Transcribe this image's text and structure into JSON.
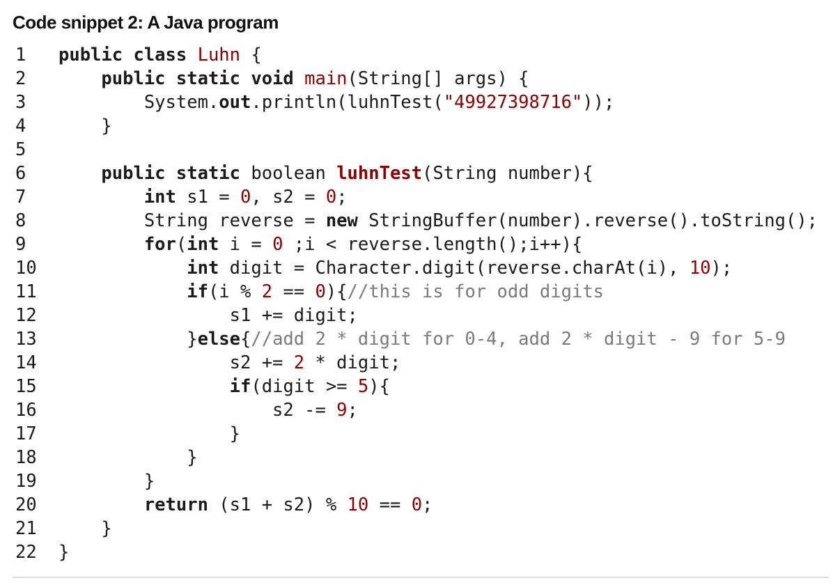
{
  "snippet": {
    "title": "Code snippet 2: A Java program",
    "lines": [
      {
        "number": "1",
        "tokens": [
          {
            "t": "public class ",
            "k": "keyword"
          },
          {
            "t": "Luhn",
            "k": "class"
          },
          {
            "t": " {",
            "k": "plain"
          }
        ]
      },
      {
        "number": "2",
        "tokens": [
          {
            "t": "    ",
            "k": "plain"
          },
          {
            "t": "public static void ",
            "k": "keyword"
          },
          {
            "t": "main",
            "k": "method"
          },
          {
            "t": "(String[] args) {",
            "k": "plain"
          }
        ]
      },
      {
        "number": "3",
        "tokens": [
          {
            "t": "        System.",
            "k": "plain"
          },
          {
            "t": "out",
            "k": "field"
          },
          {
            "t": ".println(luhnTest(",
            "k": "plain"
          },
          {
            "t": "\"49927398716\"",
            "k": "string"
          },
          {
            "t": "));",
            "k": "plain"
          }
        ]
      },
      {
        "number": "4",
        "tokens": [
          {
            "t": "    }",
            "k": "plain"
          }
        ]
      },
      {
        "number": "5",
        "tokens": []
      },
      {
        "number": "6",
        "tokens": [
          {
            "t": "    ",
            "k": "plain"
          },
          {
            "t": "public static ",
            "k": "keyword"
          },
          {
            "t": "boolean ",
            "k": "plain"
          },
          {
            "t": "luhnTest",
            "k": "method-bold"
          },
          {
            "t": "(String number){",
            "k": "plain"
          }
        ]
      },
      {
        "number": "7",
        "tokens": [
          {
            "t": "        ",
            "k": "plain"
          },
          {
            "t": "int",
            "k": "keyword"
          },
          {
            "t": " s1 = ",
            "k": "plain"
          },
          {
            "t": "0",
            "k": "number"
          },
          {
            "t": ", s2 = ",
            "k": "plain"
          },
          {
            "t": "0",
            "k": "number"
          },
          {
            "t": ";",
            "k": "plain"
          }
        ]
      },
      {
        "number": "8",
        "tokens": [
          {
            "t": "        String reverse = ",
            "k": "plain"
          },
          {
            "t": "new",
            "k": "keyword"
          },
          {
            "t": " StringBuffer(number).reverse().toString();",
            "k": "plain"
          }
        ]
      },
      {
        "number": "9",
        "tokens": [
          {
            "t": "        ",
            "k": "plain"
          },
          {
            "t": "for",
            "k": "keyword"
          },
          {
            "t": "(",
            "k": "plain"
          },
          {
            "t": "int",
            "k": "keyword"
          },
          {
            "t": " i = ",
            "k": "plain"
          },
          {
            "t": "0",
            "k": "number"
          },
          {
            "t": " ;i < reverse.length();i++){",
            "k": "plain"
          }
        ]
      },
      {
        "number": "10",
        "tokens": [
          {
            "t": "            ",
            "k": "plain"
          },
          {
            "t": "int",
            "k": "keyword"
          },
          {
            "t": " digit = Character.digit(reverse.charAt(i), ",
            "k": "plain"
          },
          {
            "t": "10",
            "k": "number"
          },
          {
            "t": ");",
            "k": "plain"
          }
        ]
      },
      {
        "number": "11",
        "tokens": [
          {
            "t": "            ",
            "k": "plain"
          },
          {
            "t": "if",
            "k": "keyword"
          },
          {
            "t": "(i % ",
            "k": "plain"
          },
          {
            "t": "2",
            "k": "number"
          },
          {
            "t": " == ",
            "k": "plain"
          },
          {
            "t": "0",
            "k": "number"
          },
          {
            "t": "){",
            "k": "plain"
          },
          {
            "t": "//this is for odd digits",
            "k": "comment"
          }
        ]
      },
      {
        "number": "12",
        "tokens": [
          {
            "t": "                s1 += digit;",
            "k": "plain"
          }
        ]
      },
      {
        "number": "13",
        "tokens": [
          {
            "t": "            }",
            "k": "plain"
          },
          {
            "t": "else",
            "k": "keyword"
          },
          {
            "t": "{",
            "k": "plain"
          },
          {
            "t": "//add 2 * digit for 0-4, add 2 * digit - 9 for 5-9",
            "k": "comment"
          }
        ]
      },
      {
        "number": "14",
        "tokens": [
          {
            "t": "                s2 += ",
            "k": "plain"
          },
          {
            "t": "2",
            "k": "number"
          },
          {
            "t": " * digit;",
            "k": "plain"
          }
        ]
      },
      {
        "number": "15",
        "tokens": [
          {
            "t": "                ",
            "k": "plain"
          },
          {
            "t": "if",
            "k": "keyword"
          },
          {
            "t": "(digit >= ",
            "k": "plain"
          },
          {
            "t": "5",
            "k": "number"
          },
          {
            "t": "){",
            "k": "plain"
          }
        ]
      },
      {
        "number": "16",
        "tokens": [
          {
            "t": "                    s2 -= ",
            "k": "plain"
          },
          {
            "t": "9",
            "k": "number"
          },
          {
            "t": ";",
            "k": "plain"
          }
        ]
      },
      {
        "number": "17",
        "tokens": [
          {
            "t": "                }",
            "k": "plain"
          }
        ]
      },
      {
        "number": "18",
        "tokens": [
          {
            "t": "            }",
            "k": "plain"
          }
        ]
      },
      {
        "number": "19",
        "tokens": [
          {
            "t": "        }",
            "k": "plain"
          }
        ]
      },
      {
        "number": "20",
        "tokens": [
          {
            "t": "        ",
            "k": "plain"
          },
          {
            "t": "return",
            "k": "keyword"
          },
          {
            "t": " (s1 + s2) % ",
            "k": "plain"
          },
          {
            "t": "10",
            "k": "number"
          },
          {
            "t": " == ",
            "k": "plain"
          },
          {
            "t": "0",
            "k": "number"
          },
          {
            "t": ";",
            "k": "plain"
          }
        ]
      },
      {
        "number": "21",
        "tokens": [
          {
            "t": "    }",
            "k": "plain"
          }
        ]
      },
      {
        "number": "22",
        "tokens": [
          {
            "t": "}",
            "k": "plain"
          }
        ]
      }
    ]
  },
  "colors": {
    "keyword": "#1a1a1a",
    "identifier_accent": "#8b0000",
    "comment": "#7a7a7a",
    "rule": "#dcdcdc"
  }
}
